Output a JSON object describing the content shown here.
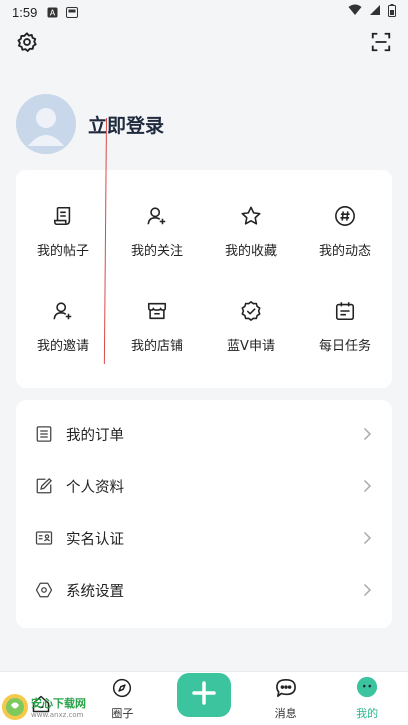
{
  "status_bar": {
    "time": "1:59",
    "icons": [
      "notification-a-icon",
      "notification-b-icon",
      "wifi-icon",
      "signal-icon",
      "battery-icon"
    ]
  },
  "header": {
    "settings_icon": "gear-icon",
    "scan_icon": "scan-icon"
  },
  "profile": {
    "login_label": "立即登录",
    "avatar_color": "#c9d7ea"
  },
  "grid_menu": {
    "items": [
      {
        "label": "我的帖子",
        "icon": "post-icon"
      },
      {
        "label": "我的关注",
        "icon": "follow-icon"
      },
      {
        "label": "我的收藏",
        "icon": "star-icon"
      },
      {
        "label": "我的动态",
        "icon": "hashtag-icon"
      },
      {
        "label": "我的邀请",
        "icon": "invite-icon"
      },
      {
        "label": "我的店铺",
        "icon": "store-icon"
      },
      {
        "label": "蓝V申请",
        "icon": "verified-badge-icon"
      },
      {
        "label": "每日任务",
        "icon": "calendar-icon"
      }
    ]
  },
  "list_menu": {
    "items": [
      {
        "label": "我的订单",
        "icon": "order-icon"
      },
      {
        "label": "个人资料",
        "icon": "edit-profile-icon"
      },
      {
        "label": "实名认证",
        "icon": "id-card-icon"
      },
      {
        "label": "系统设置",
        "icon": "hexagon-settings-icon"
      }
    ]
  },
  "tabbar": {
    "tabs": [
      {
        "label": "",
        "icon": "home-icon"
      },
      {
        "label": "圈子",
        "icon": "compass-icon"
      },
      {
        "label": "",
        "icon": "plus-icon"
      },
      {
        "label": "消息",
        "icon": "chat-icon"
      },
      {
        "label": "我的",
        "icon": "me-icon",
        "active": true
      }
    ],
    "accent_color": "#3cc49f"
  },
  "watermark": {
    "title": "安心下载网",
    "url": "www.anxz.com"
  }
}
